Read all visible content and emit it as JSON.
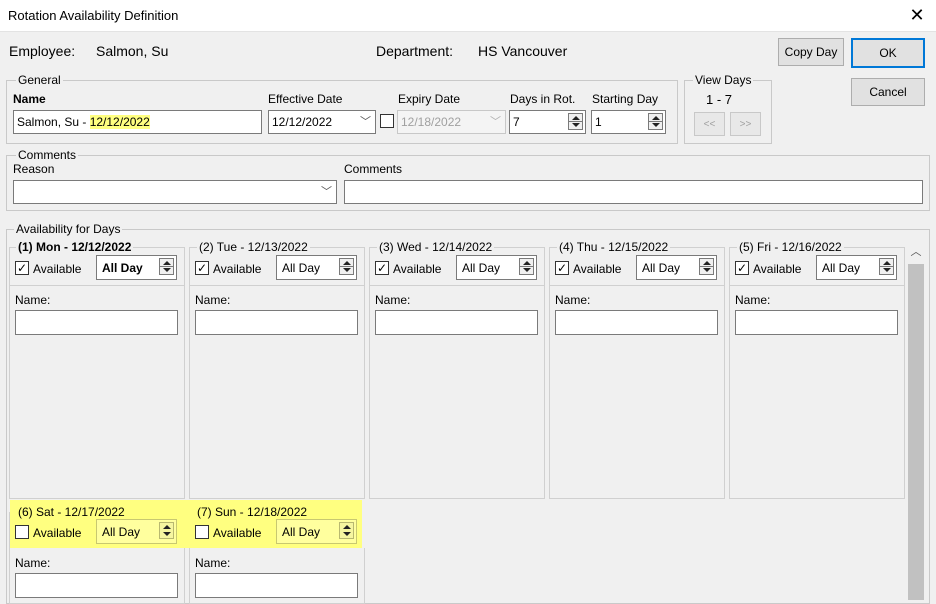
{
  "window": {
    "title": "Rotation Availability Definition",
    "close": "✕"
  },
  "header": {
    "employee_label": "Employee:",
    "employee_value": "Salmon, Su",
    "department_label": "Department:",
    "department_value": "HS Vancouver",
    "copy_day": "Copy Day",
    "ok": "OK",
    "cancel": "Cancel"
  },
  "general": {
    "legend": "General",
    "name_label": "Name",
    "name_value_prefix": "Salmon, Su - ",
    "name_value_date": "12/12/2022",
    "effective_label": "Effective Date",
    "effective_value": "12/12/2022",
    "expiry_label": "Expiry Date",
    "expiry_value": "12/18/2022",
    "days_label": "Days in Rot.",
    "days_value": "7",
    "start_label": "Starting Day",
    "start_value": "1"
  },
  "view_days": {
    "legend": "View Days",
    "range": "1 - 7",
    "prev": "<<",
    "next": ">>"
  },
  "comments": {
    "legend": "Comments",
    "reason_label": "Reason",
    "comments_label": "Comments"
  },
  "availability": {
    "legend": "Availability for Days",
    "available_label": "Available",
    "allday_label": "All Day",
    "name_label": "Name:",
    "days": [
      {
        "title": "(1) Mon - 12/12/2022",
        "checked": true
      },
      {
        "title": "(2) Tue - 12/13/2022",
        "checked": true
      },
      {
        "title": "(3) Wed - 12/14/2022",
        "checked": true
      },
      {
        "title": "(4) Thu - 12/15/2022",
        "checked": true
      },
      {
        "title": "(5) Fri - 12/16/2022",
        "checked": true
      },
      {
        "title": "(6) Sat - 12/17/2022",
        "checked": false
      },
      {
        "title": "(7) Sun - 12/18/2022",
        "checked": false
      }
    ]
  },
  "colors": {
    "highlight": "#ffff80",
    "accent": "#0078d7"
  }
}
